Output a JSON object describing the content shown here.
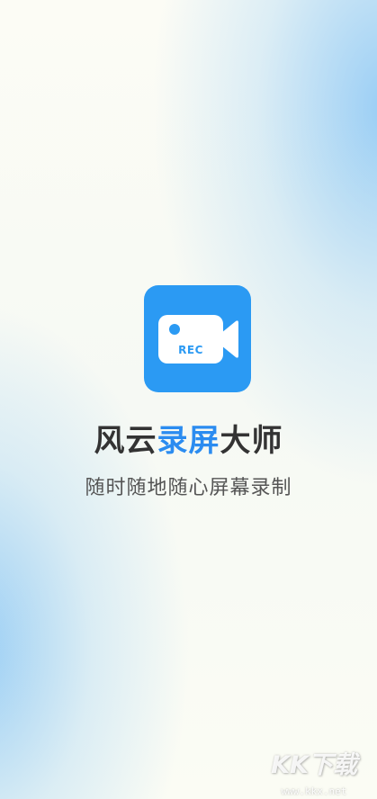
{
  "splash": {
    "icon_badge": "REC",
    "title_prefix": "风云",
    "title_highlight": "录屏",
    "title_suffix": "大师",
    "subtitle": "随时随地随心屏幕录制"
  },
  "watermark": {
    "logo": "KK下载",
    "url": "www.kkx.net"
  },
  "colors": {
    "brand_blue": "#2b9af3",
    "title_accent": "#2b8cf0",
    "title_text": "#333333",
    "subtitle_text": "#555555"
  },
  "icons": {
    "app_icon": "video-camera-icon"
  }
}
